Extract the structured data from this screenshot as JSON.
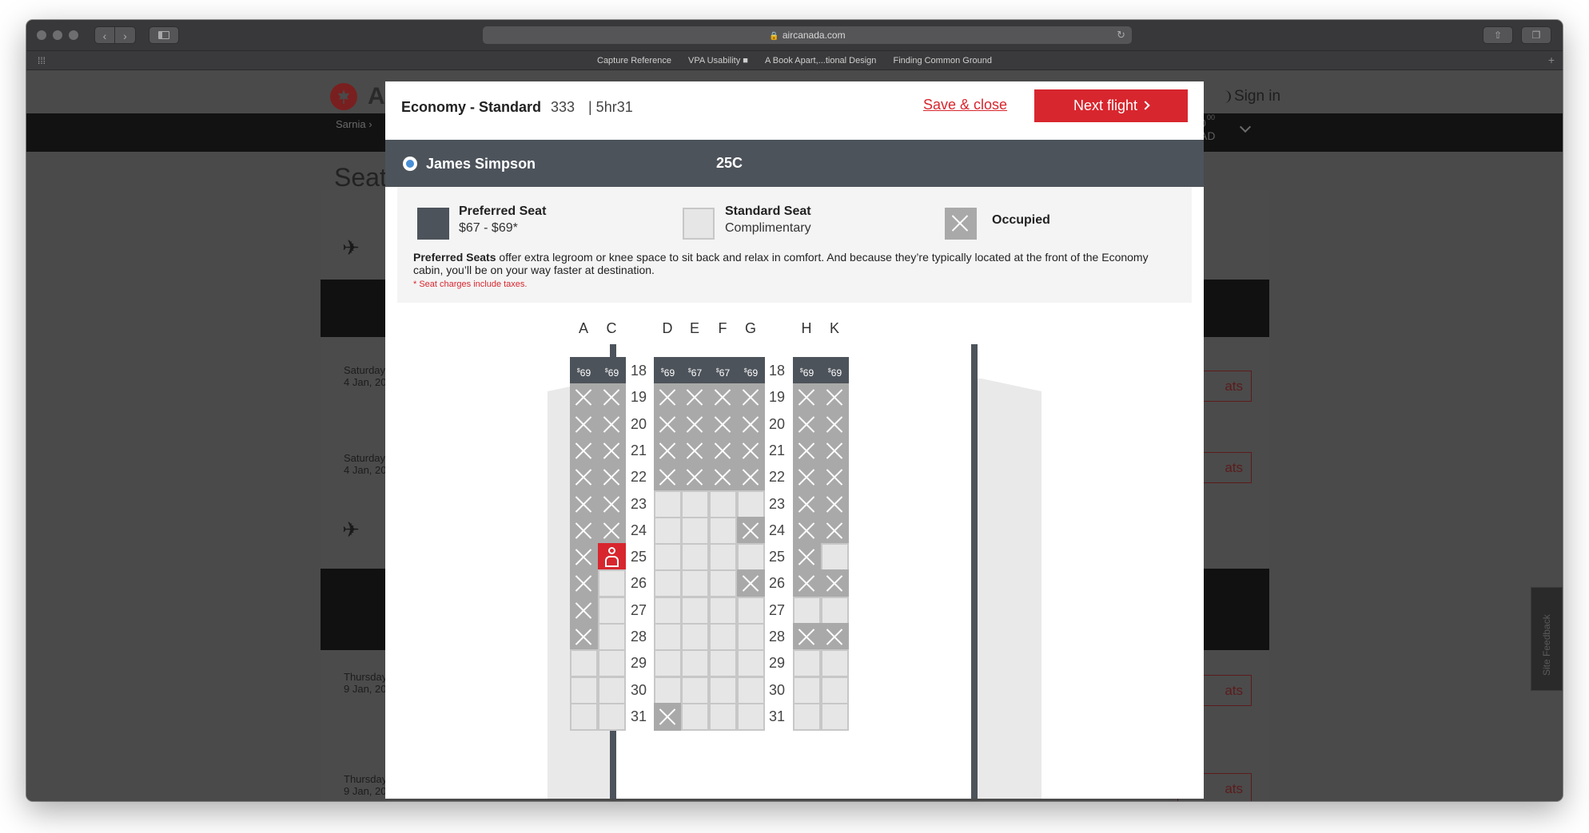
{
  "browser": {
    "url": "aircanada.com",
    "bookmarks": [
      "Capture Reference",
      "VPA Usability ■",
      "A Book Apart,...tional Design",
      "Finding Common Ground"
    ]
  },
  "background_page": {
    "brand_fragment": "A",
    "sign_in": "Sign in",
    "breadcrumb": "Sarnia",
    "price_fragment": "0",
    "price_cents_fragment": "00",
    "currency_fragment": "AD",
    "page_title_fragment": "Seat",
    "flights": [
      {
        "date_line1": "Saturday",
        "date_line2": "4 Jan, 20",
        "button_fragment": "ats"
      },
      {
        "date_line1": "Saturday",
        "date_line2": "4 Jan, 20",
        "button_fragment": "ats"
      },
      {
        "date_line1": "Thursday",
        "date_line2": "9 Jan, 20",
        "button_fragment": "ats"
      },
      {
        "date_line1": "Thursday",
        "date_line2": "9 Jan, 20",
        "button_fragment": "ats"
      }
    ],
    "site_feedback": "Site Feedback"
  },
  "modal": {
    "cabin": "Economy - Standard",
    "flight_number": "333",
    "duration": "| 5hr31",
    "save_close": "Save & close",
    "next_flight": "Next flight",
    "passenger": {
      "name": "James Simpson",
      "seat": "25C"
    },
    "legend": {
      "preferred_title": "Preferred Seat",
      "preferred_price": "$67 - $69*",
      "standard_title": "Standard Seat",
      "standard_sub": "Complimentary",
      "occupied_title": "Occupied",
      "description_bold": "Preferred Seats",
      "description_rest": " offer extra legroom or knee space to sit back and relax in comfort. And because they’re typically located at the front of the Economy cabin, you’ll be on your way faster at destination.",
      "note": "* Seat charges include taxes."
    }
  },
  "seatmap": {
    "columns": [
      "A",
      "C",
      "D",
      "E",
      "F",
      "G",
      "H",
      "K"
    ],
    "rows": [
      {
        "num": "18",
        "seats": [
          "$69",
          "$69",
          "$69",
          "$67",
          "$67",
          "$69",
          "$69",
          "$69"
        ]
      },
      {
        "num": "19",
        "seats": [
          "X",
          "X",
          "X",
          "X",
          "X",
          "X",
          "X",
          "X"
        ]
      },
      {
        "num": "20",
        "seats": [
          "X",
          "X",
          "X",
          "X",
          "X",
          "X",
          "X",
          "X"
        ]
      },
      {
        "num": "21",
        "seats": [
          "X",
          "X",
          "X",
          "X",
          "X",
          "X",
          "X",
          "X"
        ]
      },
      {
        "num": "22",
        "seats": [
          "X",
          "X",
          "X",
          "X",
          "X",
          "X",
          "X",
          "X"
        ]
      },
      {
        "num": "23",
        "seats": [
          "X",
          "X",
          "O",
          "O",
          "O",
          "O",
          "X",
          "X"
        ]
      },
      {
        "num": "24",
        "seats": [
          "X",
          "X",
          "O",
          "O",
          "O",
          "X",
          "X",
          "X"
        ]
      },
      {
        "num": "25",
        "seats": [
          "X",
          "S",
          "O",
          "O",
          "O",
          "O",
          "X",
          "O"
        ]
      },
      {
        "num": "26",
        "seats": [
          "X",
          "O",
          "O",
          "O",
          "O",
          "X",
          "X",
          "X"
        ]
      },
      {
        "num": "27",
        "seats": [
          "X",
          "O",
          "O",
          "O",
          "O",
          "O",
          "O",
          "O"
        ]
      },
      {
        "num": "28",
        "seats": [
          "X",
          "O",
          "O",
          "O",
          "O",
          "O",
          "X",
          "X"
        ]
      },
      {
        "num": "29",
        "seats": [
          "O",
          "O",
          "O",
          "O",
          "O",
          "O",
          "O",
          "O"
        ]
      },
      {
        "num": "30",
        "seats": [
          "O",
          "O",
          "O",
          "O",
          "O",
          "O",
          "O",
          "O"
        ]
      },
      {
        "num": "31",
        "seats": [
          "O",
          "O",
          "X",
          "O",
          "O",
          "O",
          "O",
          "O"
        ]
      }
    ]
  }
}
